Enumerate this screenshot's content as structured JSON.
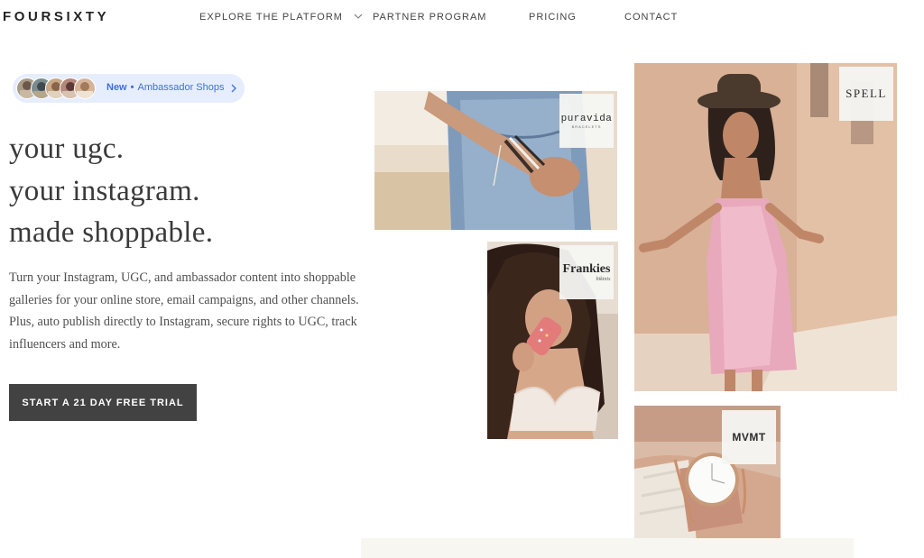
{
  "header": {
    "logo": "FOURSIXTY",
    "nav": [
      {
        "label": "EXPLORE THE PLATFORM",
        "has_dropdown": true,
        "icon": "chevron-down-icon"
      },
      {
        "label": "PARTNER PROGRAM",
        "has_dropdown": false
      },
      {
        "label": "PRICING",
        "has_dropdown": false
      },
      {
        "label": "CONTACT",
        "has_dropdown": false
      }
    ]
  },
  "announcement": {
    "new_label": "New",
    "separator": "•",
    "text": "Ambassador Shops",
    "icon": "chevron-right-icon",
    "avatar_count": 5
  },
  "hero": {
    "headline": [
      "your ugc.",
      "your instagram.",
      "made shoppable."
    ],
    "description": "Turn your Instagram, UGC, and ambassador content into shoppable galleries for your online store, email campaigns, and other channels. Plus, auto publish directly to Instagram, secure rights to UGC, track influencers and more.",
    "cta_label": "START A 21 DAY FREE TRIAL"
  },
  "gallery": [
    {
      "brand": "puravida",
      "sub": "BRACELETS",
      "photo": "denim-bracelets-photo"
    },
    {
      "brand": "SPELL",
      "sub": "",
      "photo": "woman-pink-slip-dress-photo"
    },
    {
      "brand": "Frankies",
      "sub": "bikinis",
      "photo": "woman-popsicle-photo"
    },
    {
      "brand": "MVMT",
      "sub": "",
      "photo": "rose-gold-watch-photo"
    }
  ],
  "colors": {
    "accent_blue": "#3f6fd9",
    "pill_bg": "#e6eefd",
    "cta_bg": "#424242",
    "text_dark": "#3a3a3a"
  }
}
